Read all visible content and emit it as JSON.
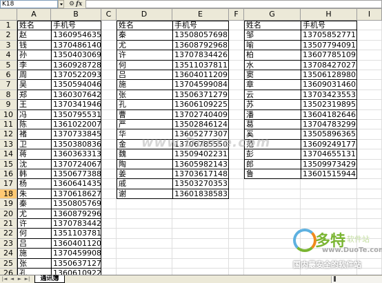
{
  "formula_bar": {
    "name_box": "K18",
    "fx_label": "fx"
  },
  "columns": [
    "A",
    "B",
    "C",
    "D",
    "E",
    "F",
    "G",
    "H",
    "I"
  ],
  "rows": [
    {
      "n": "1",
      "A": "姓名",
      "B": "手机号",
      "D": "姓名",
      "E": "手机号",
      "G": "姓名",
      "H": "手机号"
    },
    {
      "n": "2",
      "A": "赵",
      "B": "13609546352",
      "D": "秦",
      "E": "13508057698",
      "G": "邹",
      "H": "13705852771"
    },
    {
      "n": "3",
      "A": "钱",
      "B": "13704861407",
      "D": "尤",
      "E": "13608792968",
      "G": "喻",
      "H": "13507794091"
    },
    {
      "n": "4",
      "A": "孙",
      "B": "13504030698",
      "D": "许",
      "E": "13707834426",
      "G": "柏",
      "H": "13607785109"
    },
    {
      "n": "5",
      "A": "李",
      "B": "13609287283",
      "D": "何",
      "E": "13511037811",
      "G": "水",
      "H": "13708427027"
    },
    {
      "n": "6",
      "A": "周",
      "B": "13705220930",
      "D": "吕",
      "E": "13604011209",
      "G": "窦",
      "H": "13506128980"
    },
    {
      "n": "7",
      "A": "吴",
      "B": "13505940463",
      "D": "施",
      "E": "13704599084",
      "G": "章",
      "H": "13609031460"
    },
    {
      "n": "8",
      "A": "郑",
      "B": "13603076425",
      "D": "张",
      "E": "13506371279",
      "G": "云",
      "H": "13703423553"
    },
    {
      "n": "9",
      "A": "王",
      "B": "13703419464",
      "D": "孔",
      "E": "13606109225",
      "G": "苏",
      "H": "13502319895"
    },
    {
      "n": "10",
      "A": "冯",
      "B": "13507955319",
      "D": "曹",
      "E": "13702740409",
      "G": "潘",
      "H": "13604182646"
    },
    {
      "n": "11",
      "A": "陈",
      "B": "13610220077",
      "D": "严",
      "E": "13502846124",
      "G": "葛",
      "H": "13704783299"
    },
    {
      "n": "12",
      "A": "褚",
      "B": "13707338457",
      "D": "华",
      "E": "13605277307",
      "G": "奚",
      "H": "13505896365"
    },
    {
      "n": "13",
      "A": "卫",
      "B": "13503808369",
      "D": "金",
      "E": "13706785550",
      "G": "范",
      "H": "13609249177"
    },
    {
      "n": "14",
      "A": "蒋",
      "B": "13603633138",
      "D": "魏",
      "E": "13509402231",
      "G": "彭",
      "H": "13704655131"
    },
    {
      "n": "15",
      "A": "沈",
      "B": "13707240670",
      "D": "陶",
      "E": "13605982143",
      "G": "郎",
      "H": "13509973429"
    },
    {
      "n": "16",
      "A": "韩",
      "B": "13506773888",
      "D": "姜",
      "E": "13703617148",
      "G": "鲁",
      "H": "13601515944"
    },
    {
      "n": "17",
      "A": "杨",
      "B": "13606414355",
      "D": "戚",
      "E": "13503270353",
      "G": "",
      "H": ""
    },
    {
      "n": "18",
      "A": "朱",
      "B": "13706186272",
      "D": "谢",
      "E": "13601838583",
      "G": "",
      "H": ""
    },
    {
      "n": "19",
      "A": "秦",
      "B": "13508057698",
      "D": "",
      "E": "",
      "G": "",
      "H": ""
    },
    {
      "n": "20",
      "A": "尤",
      "B": "13608792968",
      "D": "",
      "E": "",
      "G": "",
      "H": ""
    },
    {
      "n": "21",
      "A": "许",
      "B": "13707834426",
      "D": "",
      "E": "",
      "G": "",
      "H": ""
    },
    {
      "n": "22",
      "A": "何",
      "B": "13511037811",
      "D": "",
      "E": "",
      "G": "",
      "H": ""
    },
    {
      "n": "23",
      "A": "吕",
      "B": "13604011209",
      "D": "",
      "E": "",
      "G": "",
      "H": ""
    },
    {
      "n": "24",
      "A": "施",
      "B": "13704599084",
      "D": "",
      "E": "",
      "G": "",
      "H": ""
    },
    {
      "n": "25",
      "A": "张",
      "B": "13506371279",
      "D": "",
      "E": "",
      "G": "",
      "H": ""
    },
    {
      "n": "26",
      "A": "孔",
      "B": "13606109225",
      "D": "",
      "E": "",
      "G": "",
      "H": ""
    }
  ],
  "selected_row": "18",
  "sheet_tab": "通讯簿",
  "watermark": "www.Duote.com",
  "logo": {
    "main": "多特",
    "sub": "软件站",
    "url": "www.DuoTe.com",
    "slogan": "国内最安全的软件站"
  },
  "colors": {
    "header_bg": "#ece9d8",
    "selected_row_header": "#ffc973",
    "logo_green": "#7ab532"
  }
}
